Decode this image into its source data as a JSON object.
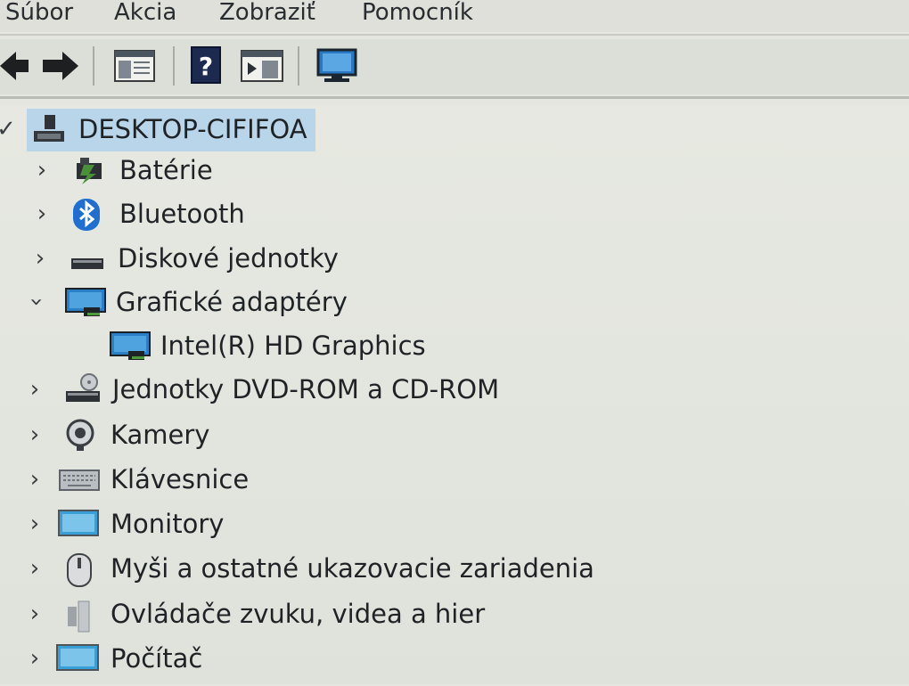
{
  "menu": {
    "items": [
      {
        "label": "Súbor"
      },
      {
        "label": "Akcia"
      },
      {
        "label": "Zobraziť"
      },
      {
        "label": "Pomocník"
      }
    ]
  },
  "toolbar": {
    "buttons": [
      {
        "icon": "back-arrow-icon"
      },
      {
        "icon": "forward-arrow-icon"
      },
      {
        "icon": "console-tree-icon"
      },
      {
        "icon": "help-icon"
      },
      {
        "icon": "action-pane-icon"
      },
      {
        "icon": "monitor-scan-icon"
      }
    ]
  },
  "tree": {
    "root": {
      "label": "DESKTOP-CIFIFOA",
      "expanded": true
    },
    "nodes": [
      {
        "label": "Batérie",
        "icon": "battery-icon",
        "expanded": false
      },
      {
        "label": "Bluetooth",
        "icon": "bluetooth-icon",
        "expanded": false
      },
      {
        "label": "Diskové jednotky",
        "icon": "disk-drive-icon",
        "expanded": false
      },
      {
        "label": "Grafické adaptéry",
        "icon": "display-adapter-icon",
        "expanded": true,
        "children": [
          {
            "label": "Intel(R) HD Graphics",
            "icon": "display-adapter-icon"
          }
        ]
      },
      {
        "label": "Jednotky DVD-ROM a CD-ROM",
        "icon": "dvd-drive-icon",
        "expanded": false
      },
      {
        "label": "Kamery",
        "icon": "camera-icon",
        "expanded": false
      },
      {
        "label": "Klávesnice",
        "icon": "keyboard-icon",
        "expanded": false
      },
      {
        "label": "Monitory",
        "icon": "monitor-icon",
        "expanded": false
      },
      {
        "label": "Myši a ostatné ukazovacie zariadenia",
        "icon": "mouse-icon",
        "expanded": false
      },
      {
        "label": "Ovládače zvuku, videa a hier",
        "icon": "speaker-icon",
        "expanded": false
      },
      {
        "label": "Počítač",
        "icon": "computer-icon",
        "expanded": false
      }
    ]
  },
  "colors": {
    "selection": "#b9d5ea",
    "background": "#e4e6df",
    "bluetooth": "#1e6fd0",
    "monitor": "#3a9fd6"
  }
}
